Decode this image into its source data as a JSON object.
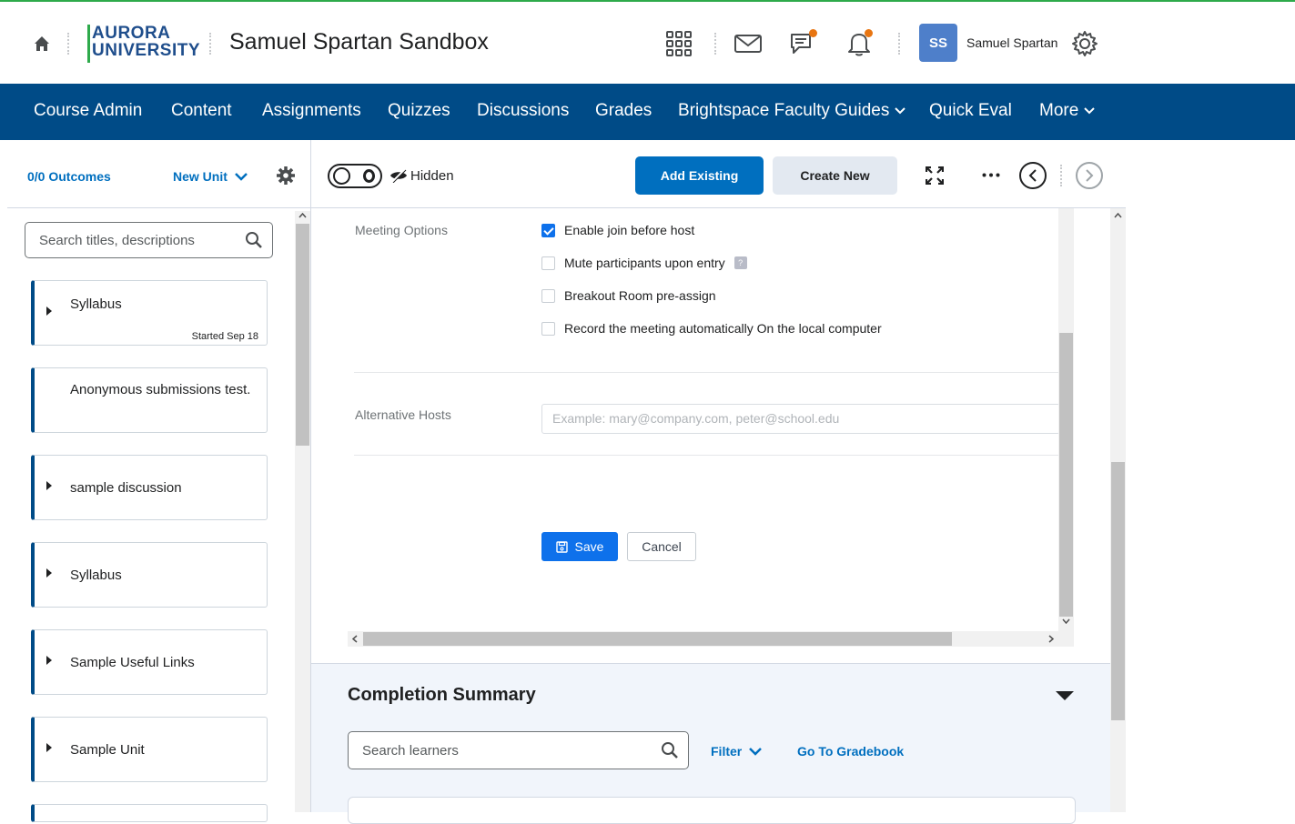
{
  "header": {
    "logo_line1": "AURORA",
    "logo_line2": "UNIVERSITY",
    "site_title": "Samuel Spartan Sandbox",
    "avatar_initials": "SS",
    "user_name": "Samuel Spartan",
    "icons": [
      "home-icon",
      "apps-grid-icon",
      "mail-icon",
      "chat-icon",
      "bell-icon",
      "gear-icon"
    ]
  },
  "nav": {
    "items": [
      "Course Admin",
      "Content",
      "Assignments",
      "Quizzes",
      "Discussions",
      "Grades",
      "Brightspace Faculty Guides",
      "Quick Eval",
      "More"
    ]
  },
  "sidebar": {
    "outcomes": "0/0 Outcomes",
    "new_unit": "New Unit",
    "search_placeholder": "Search titles, descriptions",
    "units": [
      {
        "title": "Syllabus",
        "meta": "Started Sep 18"
      },
      {
        "title": "Anonymous submissions test.",
        "meta": ""
      },
      {
        "title": "sample discussion",
        "meta": ""
      },
      {
        "title": "Syllabus",
        "meta": ""
      },
      {
        "title": "Sample Useful Links",
        "meta": ""
      },
      {
        "title": "Sample Unit",
        "meta": ""
      }
    ]
  },
  "toolbar": {
    "visibility_label": "Hidden",
    "add_existing": "Add Existing",
    "create_new": "Create New"
  },
  "meeting_form": {
    "meeting_options_label": "Meeting Options",
    "options": [
      {
        "label": "Enable join before host",
        "checked": true
      },
      {
        "label": "Mute participants upon entry",
        "checked": false
      },
      {
        "label": "Breakout Room pre-assign",
        "checked": false
      },
      {
        "label": "Record the meeting automatically On the local computer",
        "checked": false
      }
    ],
    "alt_hosts_label": "Alternative Hosts",
    "alt_hosts_placeholder": "Example: mary@company.com, peter@school.edu",
    "save": "Save",
    "cancel": "Cancel"
  },
  "completion": {
    "title": "Completion Summary",
    "search_placeholder": "Search learners",
    "filter": "Filter",
    "gradebook": "Go To Gradebook"
  },
  "colors": {
    "nav_bg": "#004b87",
    "primary": "#006fbf",
    "zoom_blue": "#0e71eb",
    "badge": "#e87511",
    "avatar": "#4e7fca"
  }
}
